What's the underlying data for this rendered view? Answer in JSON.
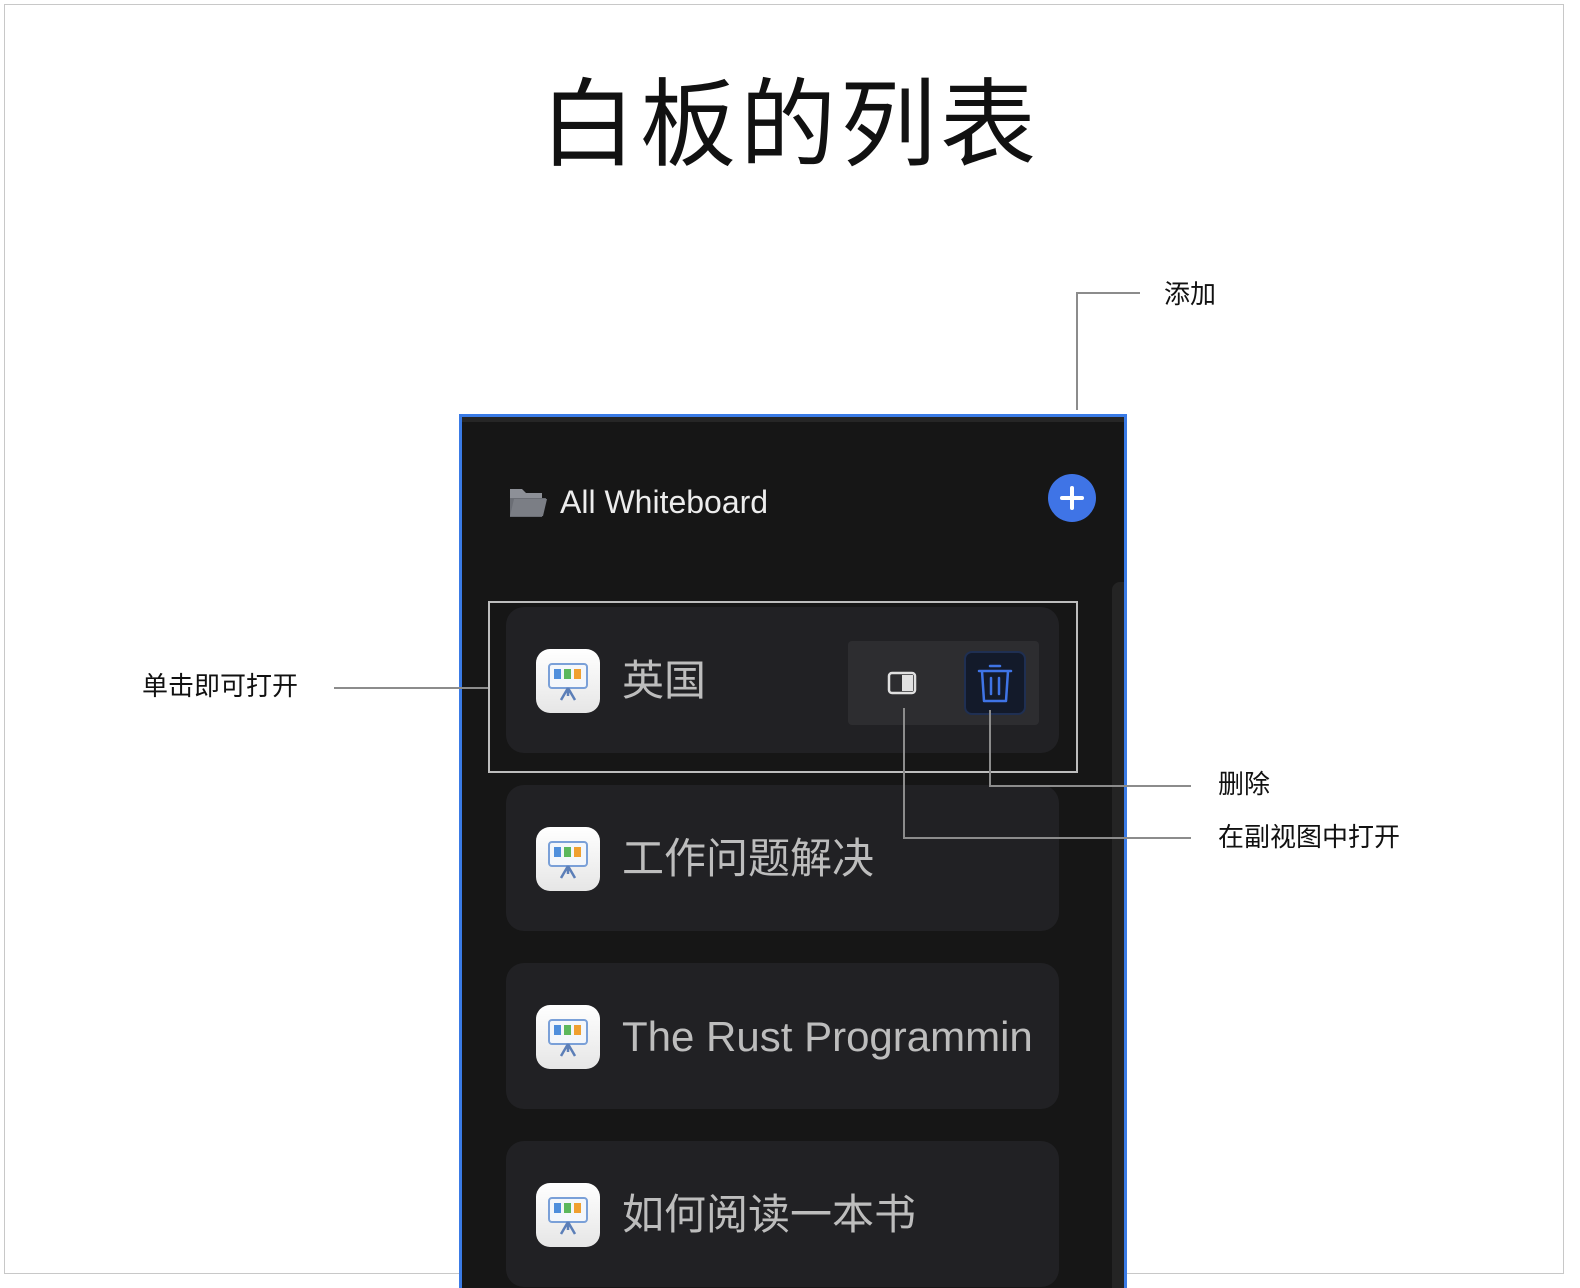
{
  "title": "白板的列表",
  "annotations": {
    "add": "添加",
    "single_click_open": "单击即可打开",
    "delete": "删除",
    "open_in_sub_view": "在副视图中打开"
  },
  "panel": {
    "header_title": "All Whiteboard",
    "items": [
      {
        "label": "英国"
      },
      {
        "label": "工作问题解决"
      },
      {
        "label": "The Rust Programming"
      },
      {
        "label": "如何阅读一本书"
      }
    ]
  },
  "colors": {
    "accent": "#3f74e6",
    "panel_border": "#3a7be6",
    "panel_bg": "#161616",
    "item_bg": "#212124"
  },
  "icons": [
    "folder-icon",
    "plus-icon",
    "whiteboard-icon",
    "split-view-icon",
    "trash-icon"
  ]
}
